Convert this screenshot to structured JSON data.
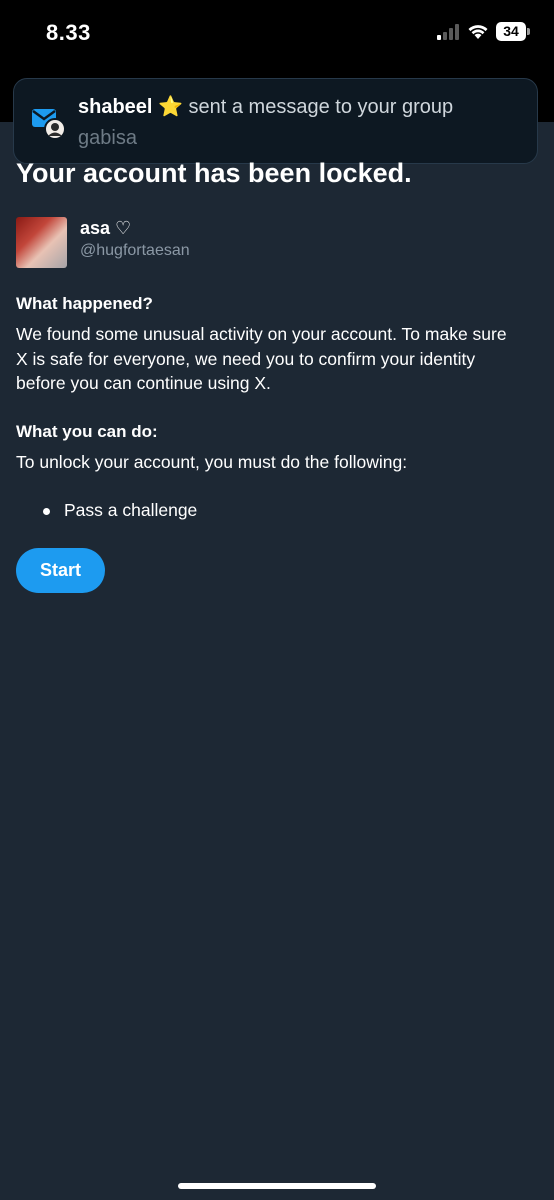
{
  "status_bar": {
    "time": "8.33",
    "battery": "34",
    "icons": [
      "signal-icon",
      "wifi-icon",
      "battery-icon"
    ]
  },
  "notification": {
    "sender": "shabeel",
    "emoji": "⭐",
    "message": "sent a message to your group",
    "group": "gabisa",
    "icon": "messenger-app-icon"
  },
  "page": {
    "title": "Your account has been locked.",
    "user": {
      "display_name": "asa ♡",
      "handle": "@hugfortaesan"
    },
    "what_happened": {
      "heading": "What happened?",
      "body": "We found some unusual activity on your account. To make sure X is safe for everyone, we need you to confirm your identity before you can continue using X."
    },
    "what_you_can_do": {
      "heading": "What you can do:",
      "body": "To unlock your account, you must do the following:",
      "items": [
        "Pass a challenge"
      ]
    },
    "start_label": "Start"
  },
  "colors": {
    "background": "#1d2834",
    "accent": "#1d9bf0",
    "muted": "#8b98a5"
  }
}
